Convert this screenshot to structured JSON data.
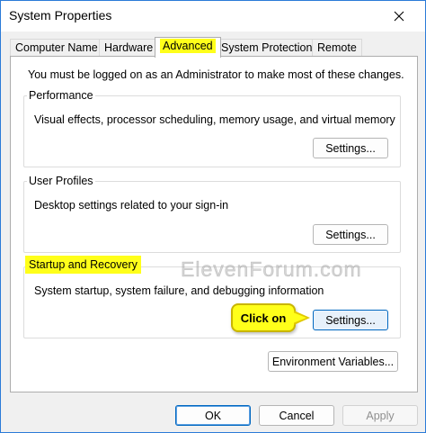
{
  "window": {
    "title": "System Properties",
    "close_glyph": "✕",
    "accent": "#2b7bd8"
  },
  "tabs": [
    {
      "label": "Computer Name",
      "active": false
    },
    {
      "label": "Hardware",
      "active": false
    },
    {
      "label": "Advanced",
      "active": true
    },
    {
      "label": "System Protection",
      "active": false
    },
    {
      "label": "Remote",
      "active": false
    }
  ],
  "panel": {
    "admin_note": "You must be logged on as an Administrator to make most of these changes.",
    "performance": {
      "title": "Performance",
      "description": "Visual effects, processor scheduling, memory usage, and virtual memory",
      "button": "Settings..."
    },
    "user_profiles": {
      "title": "User Profiles",
      "description": "Desktop settings related to your sign-in",
      "button": "Settings..."
    },
    "startup_recovery": {
      "title": "Startup and Recovery",
      "description": "System startup, system failure, and debugging information",
      "button": "Settings..."
    },
    "environment_button": "Environment Variables..."
  },
  "callout": {
    "text": "Click on",
    "color": "#ffff1a"
  },
  "watermark": "ElevenForum.com",
  "footer": {
    "ok": "OK",
    "cancel": "Cancel",
    "apply": "Apply"
  }
}
